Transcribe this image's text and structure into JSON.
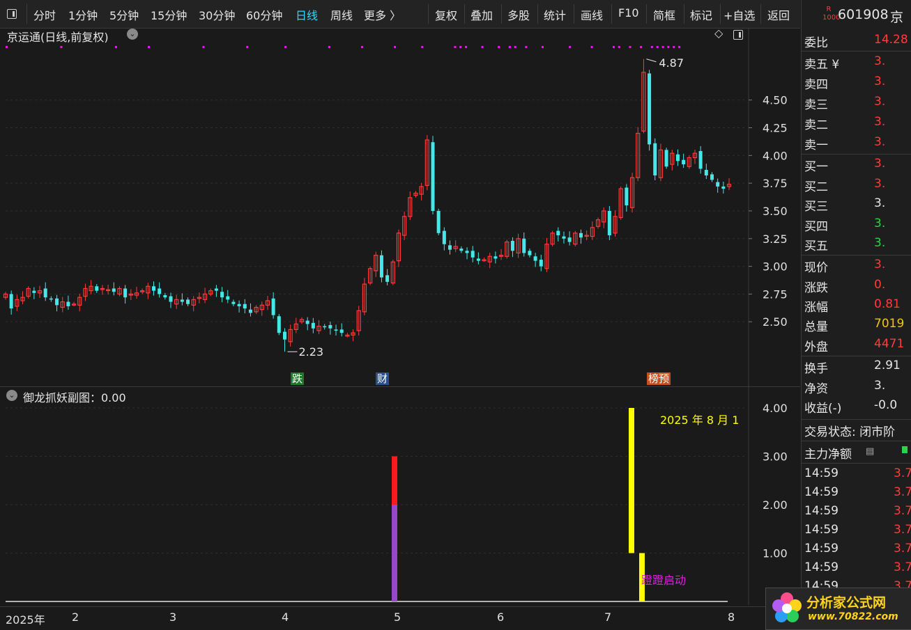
{
  "toolbar": {
    "items": [
      "分时",
      "1分钟",
      "5分钟",
      "15分钟",
      "30分钟",
      "60分钟",
      "日线",
      "周线",
      "更多 〉",
      "复权",
      "叠加",
      "多股",
      "统计",
      "画线",
      "F10",
      "简框",
      "标记",
      "+自选",
      "返回"
    ],
    "active_index": 6
  },
  "main_chart": {
    "title": "京运通(日线,前复权)",
    "y_ticks": [
      "4.50",
      "4.25",
      "4.00",
      "3.75",
      "3.50",
      "3.25",
      "3.00",
      "2.75",
      "2.50"
    ],
    "high_label": "4.87",
    "low_label": "2.23",
    "badges": [
      "跌",
      "财",
      "榜预"
    ],
    "colors": {
      "up": "#ff3b3b",
      "down": "#44e8e8",
      "dots": "#e01ee0"
    }
  },
  "sub_chart": {
    "title": "御龙抓妖副图：0.00",
    "y_ticks": [
      "4.00",
      "3.00",
      "2.00",
      "1.00"
    ],
    "date_label": "2025 年 8 月 1",
    "signal_label": "蹬蹬启动"
  },
  "x_axis": {
    "labels": [
      "2025年",
      "2",
      "3",
      "4",
      "5",
      "6",
      "7",
      "8"
    ]
  },
  "sidebar": {
    "code": "601908",
    "name_partial": "京",
    "rows": [
      {
        "k": "委比",
        "v": "14.28",
        "c": "red"
      },
      {
        "k": "卖五 ¥",
        "v": "3.",
        "c": "red"
      },
      {
        "k": "卖四",
        "v": "3.",
        "c": "red"
      },
      {
        "k": "卖三",
        "v": "3.",
        "c": "red"
      },
      {
        "k": "卖二",
        "v": "3.",
        "c": "red"
      },
      {
        "k": "卖一",
        "v": "3.",
        "c": "red"
      },
      {
        "k": "买一",
        "v": "3.",
        "c": "red"
      },
      {
        "k": "买二",
        "v": "3.",
        "c": "red"
      },
      {
        "k": "买三",
        "v": "3.",
        "c": "white"
      },
      {
        "k": "买四",
        "v": "3.",
        "c": "green"
      },
      {
        "k": "买五",
        "v": "3.",
        "c": "green"
      },
      {
        "k": "现价",
        "v": "3.",
        "c": "red"
      },
      {
        "k": "涨跌",
        "v": "0.",
        "c": "red"
      },
      {
        "k": "涨幅",
        "v": "0.81",
        "c": "red"
      },
      {
        "k": "总量",
        "v": "7019",
        "c": "gold"
      },
      {
        "k": "外盘",
        "v": "4471",
        "c": "red"
      },
      {
        "k": "换手",
        "v": "2.91",
        "c": "white"
      },
      {
        "k": "净资",
        "v": "3.",
        "c": "white"
      },
      {
        "k": "收益(-)",
        "v": "-0.0",
        "c": "white"
      }
    ],
    "trade_status": "交易状态: 闭市阶",
    "main_net": "主力净额",
    "ticks": [
      {
        "t": "14:59",
        "v": "3.7"
      },
      {
        "t": "14:59",
        "v": "3.7"
      },
      {
        "t": "14:59",
        "v": "3.7"
      },
      {
        "t": "14:59",
        "v": "3.7"
      },
      {
        "t": "14:59",
        "v": "3.7"
      },
      {
        "t": "14:59",
        "v": "3.7"
      },
      {
        "t": "14:59",
        "v": "3.7"
      }
    ]
  },
  "chart_data": {
    "type": "candlestick",
    "title": "京运通(日线,前复权)",
    "ylim": [
      2.2,
      4.9
    ],
    "x_month_labels": [
      "2",
      "3",
      "4",
      "5",
      "6",
      "7",
      "8"
    ],
    "marked_high": 4.87,
    "marked_low": 2.23,
    "closes": [
      2.75,
      2.62,
      2.7,
      2.72,
      2.8,
      2.76,
      2.78,
      2.72,
      2.7,
      2.65,
      2.68,
      2.64,
      2.66,
      2.72,
      2.8,
      2.82,
      2.78,
      2.8,
      2.79,
      2.77,
      2.8,
      2.72,
      2.75,
      2.76,
      2.78,
      2.82,
      2.78,
      2.75,
      2.72,
      2.68,
      2.7,
      2.68,
      2.66,
      2.7,
      2.72,
      2.75,
      2.78,
      2.78,
      2.72,
      2.7,
      2.66,
      2.64,
      2.62,
      2.58,
      2.63,
      2.65,
      2.69,
      2.56,
      2.4,
      2.34,
      2.43,
      2.48,
      2.52,
      2.48,
      2.44,
      2.46,
      2.45,
      2.44,
      2.42,
      2.4,
      2.38,
      2.4,
      2.6,
      2.84,
      2.98,
      3.1,
      2.9,
      2.86,
      3.04,
      3.3,
      3.45,
      3.62,
      3.66,
      3.72,
      4.14,
      3.5,
      3.3,
      3.2,
      3.15,
      3.18,
      3.14,
      3.12,
      3.08,
      3.05,
      3.06,
      3.09,
      3.07,
      3.1,
      3.22,
      3.14,
      3.25,
      3.12,
      3.1,
      3.05,
      3.0,
      3.2,
      3.3,
      3.28,
      3.25,
      3.22,
      3.3,
      3.26,
      3.28,
      3.35,
      3.42,
      3.5,
      3.28,
      3.45,
      3.7,
      3.55,
      3.8,
      4.2,
      4.75,
      4.1,
      3.82,
      4.05,
      3.9,
      4.02,
      3.95,
      3.92,
      3.98,
      4.02,
      3.88,
      3.82,
      3.78,
      3.72,
      3.7,
      3.74
    ],
    "subchart": {
      "title": "御龙抓妖副图",
      "ylim": [
        0,
        4.2
      ],
      "bars": [
        {
          "x_index": 62,
          "segments": [
            {
              "from": 0,
              "to": 2.0,
              "color": "#9b45c9"
            },
            {
              "from": 2.0,
              "to": 3.0,
              "color": "#ff1a1a"
            }
          ]
        },
        {
          "x_index": 111,
          "segments": [
            {
              "from": 1.0,
              "to": 4.0,
              "color": "#ffff00"
            }
          ]
        },
        {
          "x_index": 112,
          "segments": [
            {
              "from": 0,
              "to": 1.0,
              "color": "#ffff00"
            }
          ]
        }
      ]
    }
  }
}
